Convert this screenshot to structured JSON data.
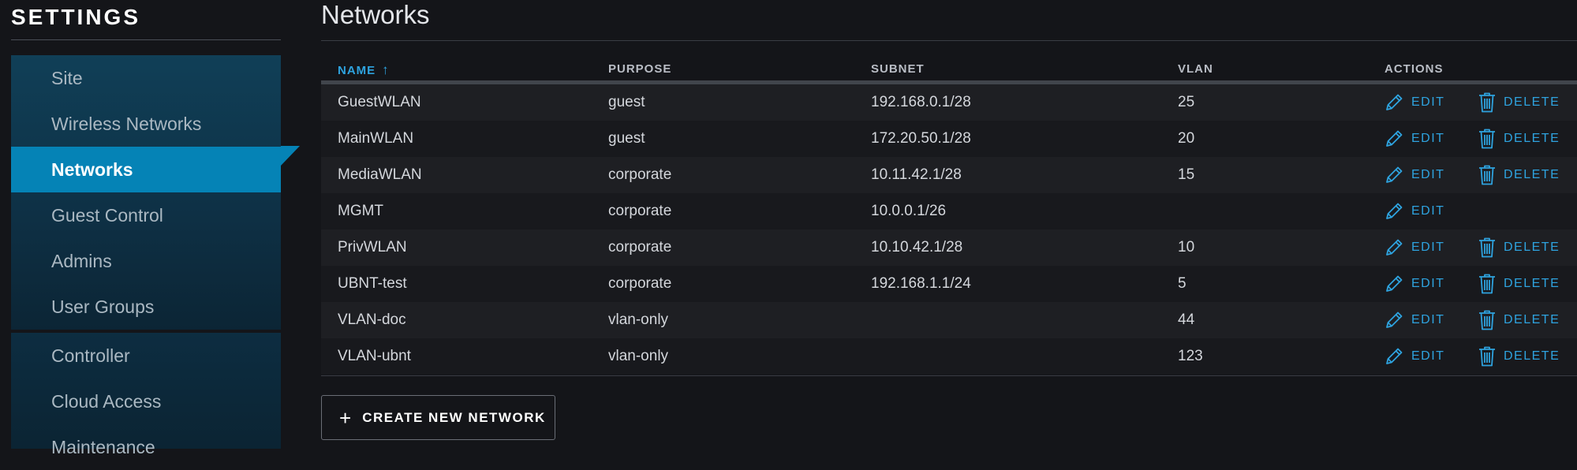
{
  "sidebar": {
    "title": "SETTINGS",
    "items": [
      {
        "label": "Site"
      },
      {
        "label": "Wireless Networks"
      },
      {
        "label": "Networks",
        "active": true
      },
      {
        "label": "Guest Control"
      },
      {
        "label": "Admins"
      },
      {
        "label": "User Groups"
      }
    ],
    "items_secondary": [
      {
        "label": "Controller"
      },
      {
        "label": "Cloud Access"
      },
      {
        "label": "Maintenance"
      }
    ]
  },
  "main": {
    "title": "Networks",
    "table": {
      "columns": {
        "name": "NAME",
        "purpose": "PURPOSE",
        "subnet": "SUBNET",
        "vlan": "VLAN",
        "actions": "ACTIONS"
      },
      "sort_indicator": "↑",
      "edit_label": "EDIT",
      "delete_label": "DELETE",
      "rows": [
        {
          "name": "GuestWLAN",
          "purpose": "guest",
          "subnet": "192.168.0.1/28",
          "vlan": "25",
          "can_delete": true
        },
        {
          "name": "MainWLAN",
          "purpose": "guest",
          "subnet": "172.20.50.1/28",
          "vlan": "20",
          "can_delete": true
        },
        {
          "name": "MediaWLAN",
          "purpose": "corporate",
          "subnet": "10.11.42.1/28",
          "vlan": "15",
          "can_delete": true
        },
        {
          "name": "MGMT",
          "purpose": "corporate",
          "subnet": "10.0.0.1/26",
          "vlan": "",
          "can_delete": false
        },
        {
          "name": "PrivWLAN",
          "purpose": "corporate",
          "subnet": "10.10.42.1/28",
          "vlan": "10",
          "can_delete": true
        },
        {
          "name": "UBNT-test",
          "purpose": "corporate",
          "subnet": "192.168.1.1/24",
          "vlan": "5",
          "can_delete": true
        },
        {
          "name": "VLAN-doc",
          "purpose": "vlan-only",
          "subnet": "",
          "vlan": "44",
          "can_delete": true
        },
        {
          "name": "VLAN-ubnt",
          "purpose": "vlan-only",
          "subnet": "",
          "vlan": "123",
          "can_delete": true
        }
      ]
    },
    "create_button": {
      "icon": "plus-icon",
      "label": "CREATE NEW NETWORK"
    }
  },
  "colors": {
    "accent": "#2ea3df",
    "active_nav": "#0583b6",
    "background": "#141519"
  }
}
